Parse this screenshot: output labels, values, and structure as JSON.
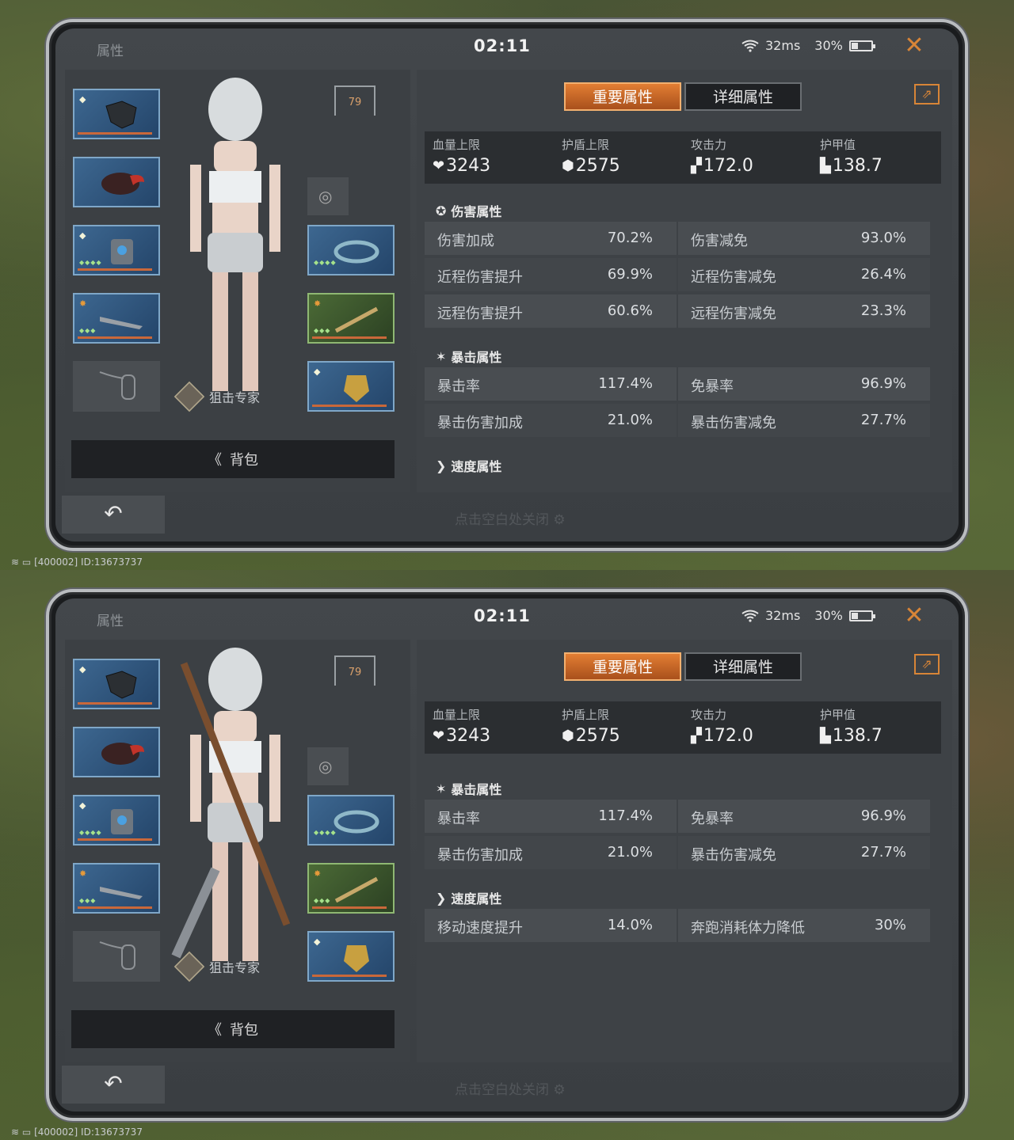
{
  "screens": [
    {
      "window_title": "属性",
      "clock": "02:11",
      "ping": "32ms",
      "battery": "30%",
      "battery_level": 0.3,
      "level": "79",
      "sniper_label": "狙击专家",
      "backpack_label": "背包",
      "backpack_chevron": "《",
      "hint": "点击空白处关闭",
      "tabs": [
        "重要属性",
        "详细属性"
      ],
      "summary": [
        {
          "label": "血量上限",
          "value": "3243",
          "icon": "heart-icon",
          "glyph": "❤"
        },
        {
          "label": "护盾上限",
          "value": "2575",
          "icon": "shield-icon",
          "glyph": "⬢"
        },
        {
          "label": "攻击力",
          "value": "172.0",
          "icon": "gun-icon",
          "glyph": "▞"
        },
        {
          "label": "护甲值",
          "value": "138.7",
          "icon": "armor-icon",
          "glyph": "▙"
        }
      ],
      "sections": {
        "damage": {
          "title": "伤害属性",
          "rows": [
            [
              "伤害加成",
              "70.2%",
              "伤害减免",
              "93.0%"
            ],
            [
              "近程伤害提升",
              "69.9%",
              "近程伤害减免",
              "26.4%"
            ],
            [
              "远程伤害提升",
              "60.6%",
              "远程伤害减免",
              "23.3%"
            ]
          ]
        },
        "crit": {
          "title": "暴击属性",
          "rows": [
            [
              "暴击率",
              "117.4%",
              "免暴率",
              "96.9%"
            ],
            [
              "暴击伤害加成",
              "21.0%",
              "暴击伤害减免",
              "27.7%"
            ]
          ]
        },
        "speed": {
          "title": "速度属性",
          "rows": []
        }
      },
      "footer": "[400002] ID:13673737"
    },
    {
      "window_title": "属性",
      "clock": "02:11",
      "ping": "32ms",
      "battery": "30%",
      "battery_level": 0.3,
      "level": "79",
      "sniper_label": "狙击专家",
      "backpack_label": "背包",
      "backpack_chevron": "《",
      "hint": "点击空白处关闭",
      "tabs": [
        "重要属性",
        "详细属性"
      ],
      "summary": [
        {
          "label": "血量上限",
          "value": "3243",
          "icon": "heart-icon",
          "glyph": "❤"
        },
        {
          "label": "护盾上限",
          "value": "2575",
          "icon": "shield-icon",
          "glyph": "⬢"
        },
        {
          "label": "攻击力",
          "value": "172.0",
          "icon": "gun-icon",
          "glyph": "▞"
        },
        {
          "label": "护甲值",
          "value": "138.7",
          "icon": "armor-icon",
          "glyph": "▙"
        }
      ],
      "sections": {
        "crit": {
          "title": "暴击属性",
          "rows": [
            [
              "暴击率",
              "117.4%",
              "免暴率",
              "96.9%"
            ],
            [
              "暴击伤害加成",
              "21.0%",
              "暴击伤害减免",
              "27.7%"
            ]
          ]
        },
        "speed": {
          "title": "速度属性",
          "rows": [
            [
              "移动速度提升",
              "14.0%",
              "奔跑消耗体力降低",
              "30%"
            ]
          ]
        }
      },
      "footer": "[400002] ID:13673737"
    }
  ]
}
